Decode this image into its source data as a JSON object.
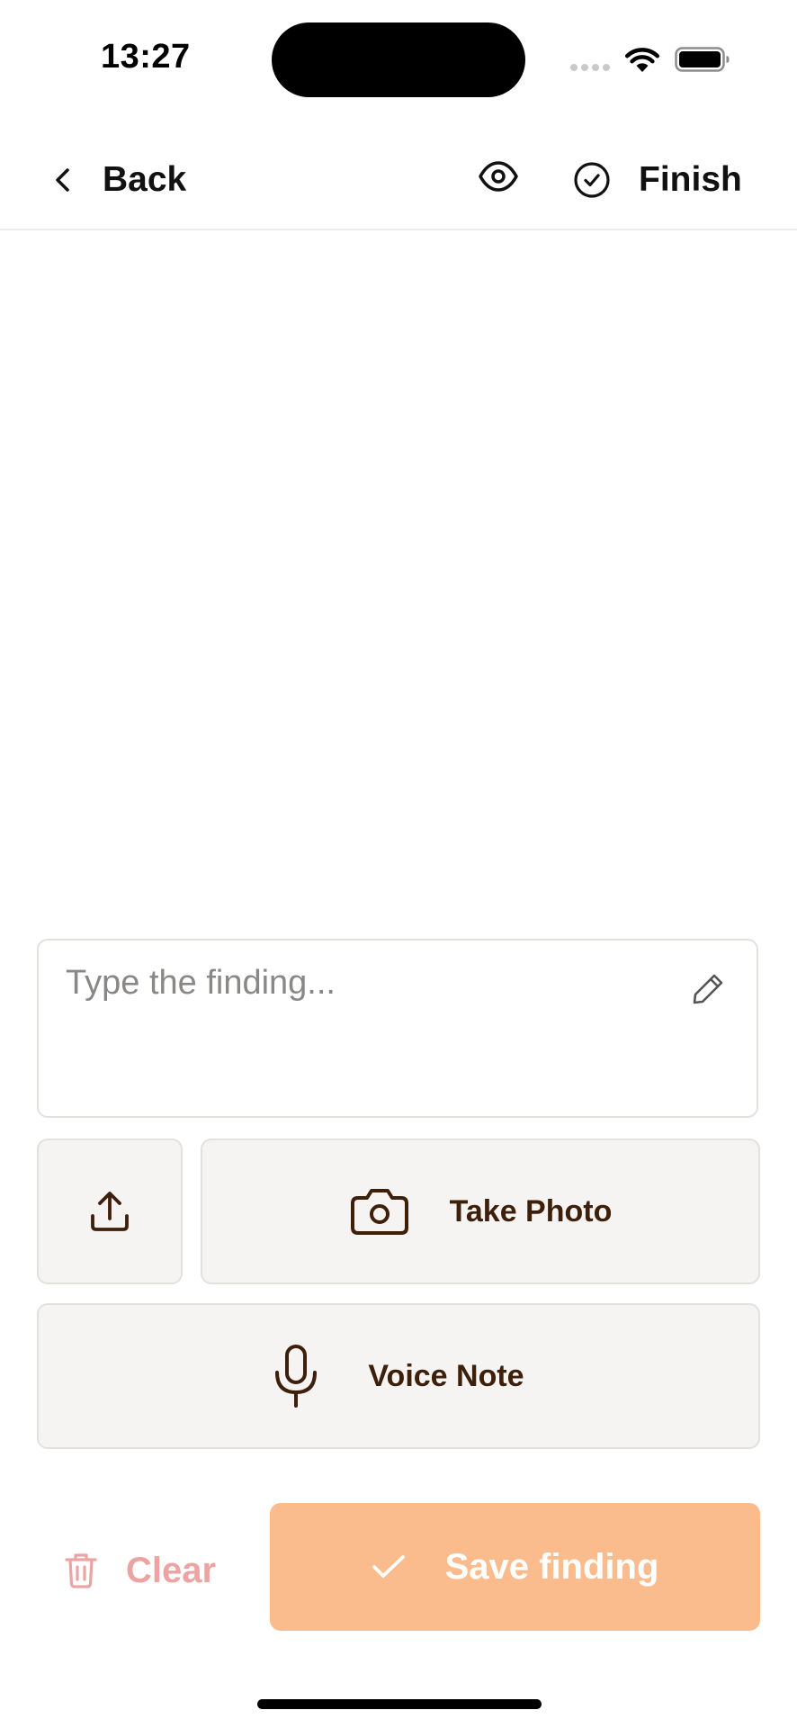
{
  "status_bar": {
    "time": "13:27"
  },
  "nav": {
    "back_label": "Back",
    "finish_label": "Finish",
    "preview_icon": "eye-icon",
    "finish_icon": "check-circle-icon"
  },
  "finding": {
    "value": "",
    "placeholder": "Type the finding...",
    "icon": "pencil-icon"
  },
  "actions": {
    "upload_icon": "upload-icon",
    "take_photo_label": "Take Photo",
    "take_photo_icon": "camera-icon",
    "voice_note_label": "Voice Note",
    "voice_note_icon": "microphone-icon"
  },
  "footer": {
    "clear_label": "Clear",
    "clear_icon": "trash-icon",
    "save_label": "Save finding",
    "save_icon": "check-icon"
  },
  "colors": {
    "accent": "#fabc8c",
    "action_text": "#3d1f0a",
    "clear_text": "#eea3a3",
    "tile_bg": "#f5f4f2",
    "tile_border": "#e3e1de"
  }
}
